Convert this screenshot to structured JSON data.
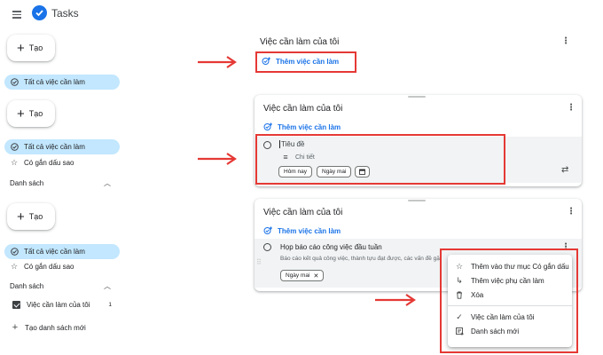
{
  "app": {
    "title": "Tasks"
  },
  "sidebar": {
    "create_label": "Tạo",
    "all_tasks": "Tất cả việc cần làm",
    "starred": "Có gắn dấu sao",
    "lists_heading": "Danh sách",
    "list_name": "Việc cần làm của tôi",
    "list_count": "1",
    "new_list": "Tạo danh sách mới"
  },
  "cards": [
    {
      "title": "Việc cần làm của tôi",
      "add_task": "Thêm việc cần làm"
    },
    {
      "title": "Việc cần làm của tôi",
      "add_task": "Thêm việc cần làm",
      "new_task_title": "Tiêu đề",
      "details_placeholder": "Chi tiết",
      "chip_today": "Hôm nay",
      "chip_tomorrow": "Ngày mai"
    },
    {
      "title": "Việc cần làm của tôi",
      "add_task": "Thêm việc cần làm",
      "task_title": "Họp báo cáo công việc đầu tuần",
      "task_details": "Báo cáo kết quả công việc, thành tựu đạt được, các vấn đề gặ",
      "chip_date": "Ngày mai"
    }
  ],
  "context_menu": {
    "items": [
      "Thêm vào thư mục Có gắn dấu",
      "Thêm việc phụ cần làm",
      "Xóa"
    ],
    "lists": [
      "Việc cần làm của tôi",
      "Danh sách mới"
    ]
  },
  "colors": {
    "accent": "#1a73e8",
    "highlight": "#e53935",
    "pill": "#c2e7ff"
  },
  "icons": [
    "menu-icon",
    "tasks-logo-icon",
    "plus-icon",
    "check-circle-icon",
    "star-icon",
    "chevron-up-icon",
    "checkbox-icon",
    "add-task-icon",
    "kebab-icon",
    "repeat-icon",
    "calendar-icon",
    "subtask-icon",
    "trash-icon",
    "check-icon",
    "new-list-icon",
    "arrow-icon"
  ]
}
